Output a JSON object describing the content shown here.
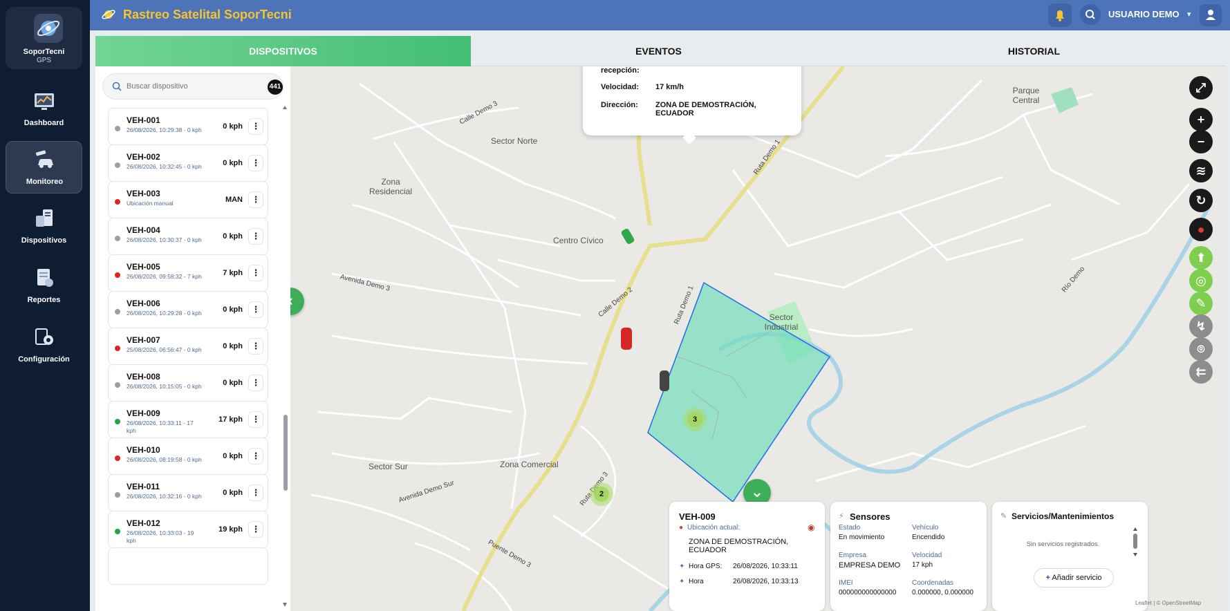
{
  "brand": {
    "name": "SoporTecni",
    "sub": "GPS"
  },
  "nav": [
    {
      "label": "Dashboard"
    },
    {
      "label": "Monitoreo"
    },
    {
      "label": "Dispositivos"
    },
    {
      "label": "Reportes"
    },
    {
      "label": "Configuración"
    }
  ],
  "header": {
    "title": "Rastreo Satelital SoporTecni",
    "user": "USUARIO DEMO"
  },
  "tabs": [
    {
      "label": "DISPOSITIVOS"
    },
    {
      "label": "EVENTOS"
    },
    {
      "label": "HISTORIAL"
    }
  ],
  "search": {
    "placeholder": "Buscar dispositivo",
    "count": "441"
  },
  "devices": [
    {
      "name": "VEH-001",
      "sub": "26/08/2026, 10:29:38 - 0 kph",
      "speed": "0 kph",
      "status": "#9aa0a6"
    },
    {
      "name": "VEH-002",
      "sub": "26/08/2026, 10:32:45 - 0 kph",
      "speed": "0 kph",
      "status": "#9aa0a6"
    },
    {
      "name": "VEH-003",
      "sub": "Ubicación manual",
      "speed": "MAN",
      "status": "#e02424"
    },
    {
      "name": "VEH-004",
      "sub": "26/08/2026, 10:30:37 - 0 kph",
      "speed": "0 kph",
      "status": "#9aa0a6"
    },
    {
      "name": "VEH-005",
      "sub": "26/08/2026, 09:58:32 - 7 kph",
      "speed": "7 kph",
      "status": "#e02424"
    },
    {
      "name": "VEH-006",
      "sub": "26/08/2026, 10:29:28 - 0 kph",
      "speed": "0 kph",
      "status": "#9aa0a6"
    },
    {
      "name": "VEH-007",
      "sub": "25/08/2026, 06:56:47 - 0 kph",
      "speed": "0 kph",
      "status": "#e02424"
    },
    {
      "name": "VEH-008",
      "sub": "26/08/2026, 10:15:05 - 0 kph",
      "speed": "0 kph",
      "status": "#9aa0a6"
    },
    {
      "name": "VEH-009",
      "sub": "26/08/2026, 10:33:11 - 17 kph",
      "speed": "17 kph",
      "status": "#22a34a"
    },
    {
      "name": "VEH-010",
      "sub": "26/08/2026, 08:19:58 - 0 kph",
      "speed": "0 kph",
      "status": "#e02424"
    },
    {
      "name": "VEH-011",
      "sub": "26/08/2026, 10:32:16 - 0 kph",
      "speed": "0 kph",
      "status": "#9aa0a6"
    },
    {
      "name": "VEH-012",
      "sub": "26/08/2026, 10:33:03 - 19 kph",
      "speed": "19 kph",
      "status": "#22a34a"
    }
  ],
  "map": {
    "areas": [
      "Sector Norte",
      "Zona Residencial",
      "Centro Cívico",
      "Sector Industrial",
      "Sector Sur",
      "Zona Comercial",
      "Parque Central"
    ],
    "roads": [
      "Calle Demo 3",
      "Ruta Demo 1",
      "Ruta Demo 1",
      "Avenida Demo 3",
      "Calle Demo 2",
      "Ruta Demo 3",
      "Avenida Demo Sur",
      "Puente Demo 3",
      "Río Demo"
    ],
    "popup": {
      "reception_label": "recepción:",
      "speed_label": "Velocidad:",
      "speed_value": "17 km/h",
      "direction_label": "Dirección:",
      "direction_value": "ZONA DE DEMOSTRACIÓN, ECUADOR"
    },
    "clusters": [
      "3",
      "2"
    ],
    "attribution": "Leaflet | © OpenStreetMap"
  },
  "vehicle_card": {
    "title": "VEH-009",
    "location_label": "Ubicación actual:",
    "location_value": "ZONA DE DEMOSTRACIÓN, ECUADOR",
    "gps_time_label": "Hora GPS:",
    "gps_time_value": "26/08/2026, 10:33:11",
    "time_label": "Hora",
    "time_value": "26/08/2026, 10:33:13"
  },
  "sensors": {
    "title": "Sensores",
    "estado_label": "Estado",
    "estado_value": "En movimiento",
    "vehiculo_label": "Vehículo",
    "vehiculo_value": "Encendido",
    "empresa_label": "Empresa",
    "empresa_value": "EMPRESA DEMO",
    "velocidad_label": "Velocidad",
    "velocidad_value": "17 kph",
    "imei_label": "IMEI",
    "imei_value": "000000000000000",
    "coord_label": "Coordenadas",
    "coord_value": "0.000000, 0.000000"
  },
  "services": {
    "title": "Servicios/Mantenimientos",
    "empty": "Sin servicios registrados.",
    "add": "Añadir servicio"
  },
  "colors": {
    "sidebar": "#0f1d33",
    "header": "#4d73b8",
    "title": "#f6c431",
    "accent_green": "#43be73",
    "geofence": "#1f6fe0"
  }
}
